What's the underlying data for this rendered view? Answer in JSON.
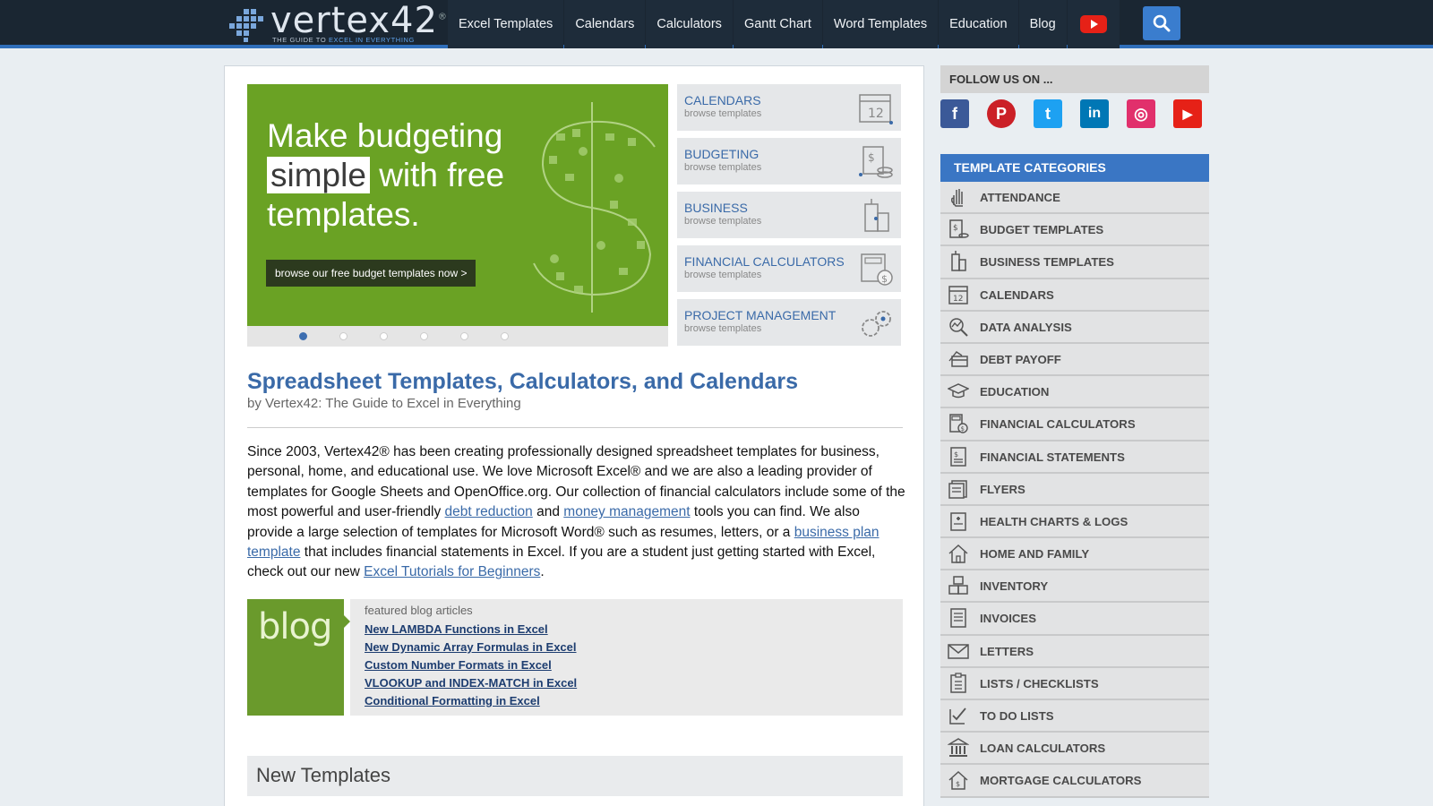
{
  "header": {
    "logo_word": "vertex42",
    "logo_reg": "®",
    "logo_tag_prefix": "THE GUIDE TO ",
    "logo_tag_highlight": "EXCEL IN EVERYTHING",
    "nav": [
      "Excel Templates",
      "Calendars",
      "Calculators",
      "Gantt Chart",
      "Word Templates",
      "Education",
      "Blog"
    ],
    "youtube_icon": "youtube-icon",
    "search_icon": "search-icon"
  },
  "hero": {
    "line1": "Make budgeting",
    "line2_highlight": "simple",
    "line2_rest": " with free",
    "line3": "templates.",
    "button": "browse our free budget templates now >",
    "slides_total": 6,
    "slide_active": 1,
    "colors": {
      "background": "#6aa224",
      "highlight": "#ffffff"
    }
  },
  "categories_featured": [
    {
      "title": "CALENDARS",
      "sub": "browse templates",
      "icon": "calendar-icon"
    },
    {
      "title": "BUDGETING",
      "sub": "browse templates",
      "icon": "budget-icon"
    },
    {
      "title": "BUSINESS",
      "sub": "browse templates",
      "icon": "building-icon"
    },
    {
      "title": "FINANCIAL CALCULATORS",
      "sub": "browse templates",
      "icon": "calculator-icon"
    },
    {
      "title": "PROJECT MANAGEMENT",
      "sub": "browse templates",
      "icon": "gears-icon"
    }
  ],
  "content": {
    "title": "Spreadsheet Templates, Calculators, and Calendars",
    "byline": "by Vertex42: The Guide to Excel in Everything",
    "intro_1": "Since 2003, Vertex42® has been creating professionally designed spreadsheet templates for business, personal, home, and educational use. We love Microsoft Excel® and we are also a leading provider of templates for Google Sheets and OpenOffice.org. Our collection of financial calculators include some of the most powerful and user-friendly ",
    "link_debt": "debt reduction",
    "intro_2": " and ",
    "link_money": "money management",
    "intro_3": " tools you can find. We also provide a large selection of templates for Microsoft Word® such as resumes, letters, or a ",
    "link_bplan": "business plan template",
    "intro_4": " that includes financial statements in Excel. If you are a student just getting started with Excel, check out our new ",
    "link_tutorials": "Excel Tutorials for Beginners",
    "intro_5": "."
  },
  "blog": {
    "logo_text": "blog",
    "heading": "featured blog articles",
    "articles": [
      "New LAMBDA Functions in Excel",
      "New Dynamic Array Formulas in Excel",
      "Custom Number Formats in Excel",
      "VLOOKUP and INDEX-MATCH in Excel",
      "Conditional Formatting in Excel"
    ]
  },
  "new_templates": {
    "heading": "New Templates"
  },
  "sidebar": {
    "follow_heading": "FOLLOW US ON ...",
    "socials": [
      {
        "name": "facebook",
        "glyph": "f",
        "color": "#3b5998"
      },
      {
        "name": "pinterest",
        "glyph": "P",
        "color": "#cb2027"
      },
      {
        "name": "twitter",
        "glyph": "t",
        "color": "#1da1f2"
      },
      {
        "name": "linkedin",
        "glyph": "in",
        "color": "#0077b5"
      },
      {
        "name": "instagram",
        "glyph": "◎",
        "color": "#e1306c"
      },
      {
        "name": "youtube",
        "glyph": "▶",
        "color": "#e62117"
      }
    ],
    "categories_heading": "TEMPLATE CATEGORIES",
    "categories": [
      "ATTENDANCE",
      "BUDGET TEMPLATES",
      "BUSINESS TEMPLATES",
      "CALENDARS",
      "DATA ANALYSIS",
      "DEBT PAYOFF",
      "EDUCATION",
      "FINANCIAL CALCULATORS",
      "FINANCIAL STATEMENTS",
      "FLYERS",
      "HEALTH CHARTS & LOGS",
      "HOME AND FAMILY",
      "INVENTORY",
      "INVOICES",
      "LETTERS",
      "LISTS / CHECKLISTS",
      "TO DO LISTS",
      "LOAN CALCULATORS",
      "MORTGAGE CALCULATORS"
    ]
  }
}
